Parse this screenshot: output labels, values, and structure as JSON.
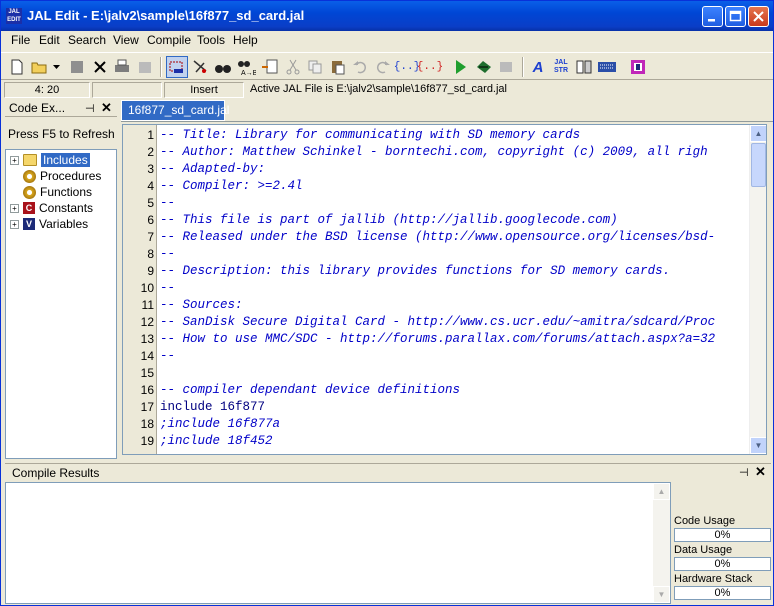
{
  "window": {
    "title": "JAL Edit - E:\\jalv2\\sample\\16f877_sd_card.jal",
    "app_icon_text": "JAL EDIT"
  },
  "menu": [
    "File",
    "Edit",
    "Search",
    "View",
    "Compile",
    "Tools",
    "Help"
  ],
  "toolbar": [
    "new-file-icon",
    "open-file-icon",
    "open-dropdown-icon",
    "save-icon",
    "close-file-icon",
    "print-icon",
    "print-preview-icon",
    "show-hide-icon",
    "find-icon",
    "binoculars-icon",
    "replace-icon",
    "goto-icon",
    "cut-icon",
    "copy-icon",
    "paste-icon",
    "undo-icon",
    "redo-icon",
    "block-comment-icon",
    "block-uncomment-icon",
    "compile-icon",
    "program-icon",
    "build-icon",
    "jal-font-icon",
    "jal-str-icon",
    "split-view-icon",
    "keyboard-icon",
    "chip-icon"
  ],
  "status": {
    "position": "4: 20",
    "mode": "Insert",
    "active_file": "Active JAL File is E:\\jalv2\\sample\\16f877_sd_card.jal"
  },
  "code_explorer": {
    "title": "Code Ex...",
    "refresh_hint": "Press F5 to Refresh",
    "items": [
      {
        "label": "Includes",
        "expander": "+",
        "icon": "folder",
        "selected": true
      },
      {
        "label": "Procedures",
        "expander": "",
        "icon": "gear"
      },
      {
        "label": "Functions",
        "expander": "",
        "icon": "gear"
      },
      {
        "label": "Constants",
        "expander": "+",
        "icon": "C"
      },
      {
        "label": "Variables",
        "expander": "+",
        "icon": "V"
      }
    ]
  },
  "editor": {
    "tab": "16f877_sd_card.jal",
    "lines": [
      {
        "n": "1",
        "text": "-- Title: Library for communicating with SD memory cards",
        "kind": "comment"
      },
      {
        "n": "2",
        "text": "-- Author: Matthew Schinkel - borntechi.com, copyright (c) 2009, all righ",
        "kind": "comment"
      },
      {
        "n": "3",
        "text": "-- Adapted-by:",
        "kind": "comment"
      },
      {
        "n": "4",
        "text": "-- Compiler: >=2.4l",
        "kind": "comment"
      },
      {
        "n": "5",
        "text": "--",
        "kind": "comment"
      },
      {
        "n": "6",
        "text": "-- This file is part of jallib (http://jallib.googlecode.com)",
        "kind": "comment"
      },
      {
        "n": "7",
        "text": "-- Released under the BSD license (http://www.opensource.org/licenses/bsd-",
        "kind": "comment"
      },
      {
        "n": "8",
        "text": "--",
        "kind": "comment"
      },
      {
        "n": "9",
        "text": "-- Description: this library provides functions for SD memory cards.",
        "kind": "comment"
      },
      {
        "n": "10",
        "text": "--",
        "kind": "comment"
      },
      {
        "n": "11",
        "text": "-- Sources:",
        "kind": "comment"
      },
      {
        "n": "12",
        "text": "-- SanDisk Secure Digital Card - http://www.cs.ucr.edu/~amitra/sdcard/Proc",
        "kind": "comment"
      },
      {
        "n": "13",
        "text": "-- How to use MMC/SDC - http://forums.parallax.com/forums/attach.aspx?a=32",
        "kind": "comment"
      },
      {
        "n": "14",
        "text": "--",
        "kind": "comment"
      },
      {
        "n": "15",
        "text": "",
        "kind": "plain"
      },
      {
        "n": "16",
        "text": "-- compiler dependant device definitions",
        "kind": "comment"
      },
      {
        "n": "17",
        "text": "include 16f877",
        "kind": "kw"
      },
      {
        "n": "18",
        "text": ";include 16f877a",
        "kind": "dis"
      },
      {
        "n": "19",
        "text": ";include 18f452",
        "kind": "dis"
      }
    ]
  },
  "results": {
    "title": "Compile Results",
    "code_usage_label": "Code Usage",
    "code_usage": "0%",
    "data_usage_label": "Data Usage",
    "data_usage": "0%",
    "stack_label": "Hardware Stack",
    "stack": "0%"
  },
  "colors": {
    "title_bar": "#0046d5",
    "tab_active": "#316ac5",
    "comment": "#0000c8",
    "keyword": "#000080"
  }
}
